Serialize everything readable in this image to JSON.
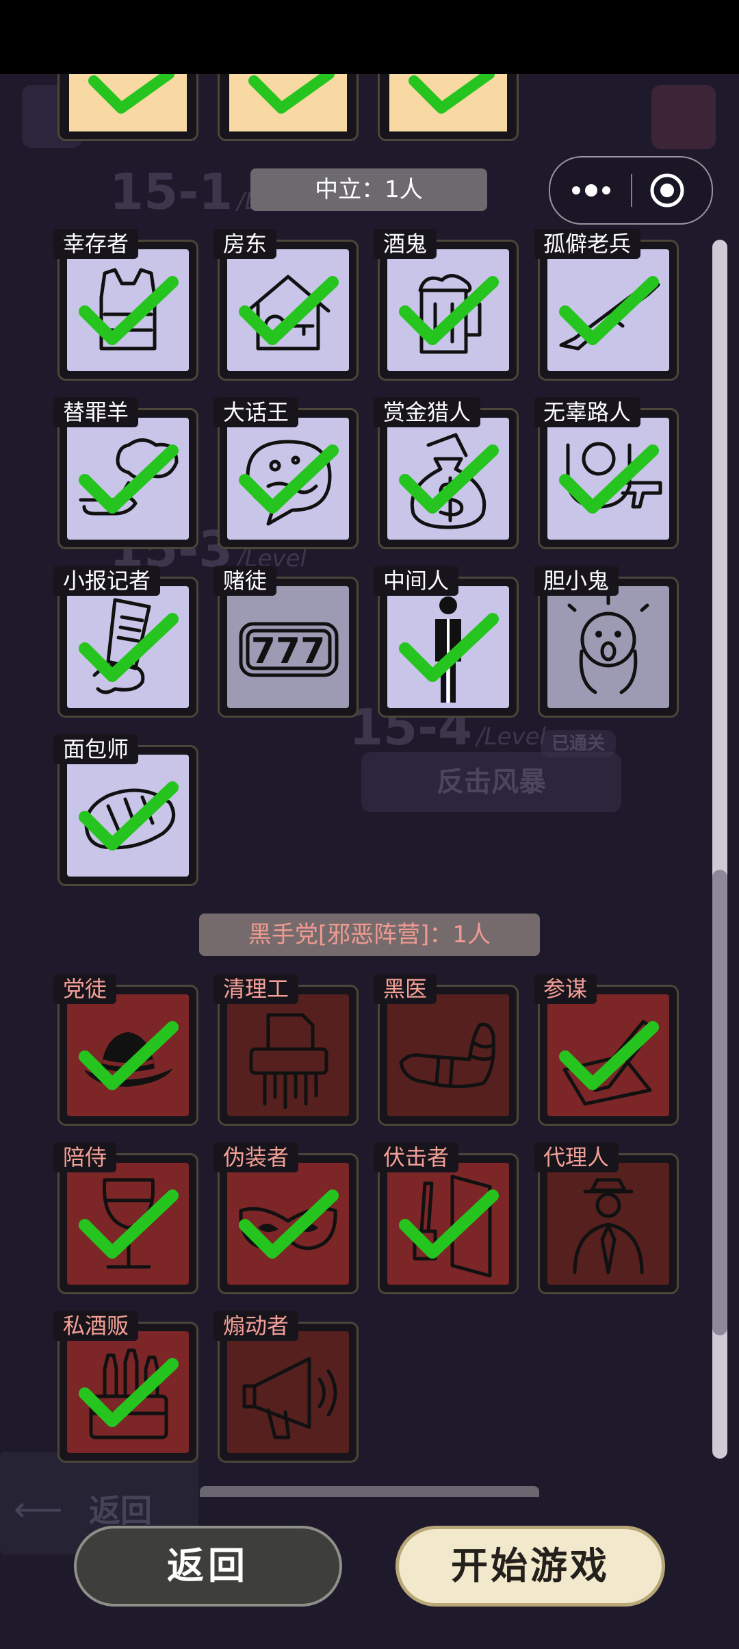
{
  "background": {
    "levels": [
      {
        "num": "15-1",
        "lvl": "/Level"
      },
      {
        "num": "15-3",
        "lvl": "/Level"
      },
      {
        "num": "15-4",
        "lvl": "/Level"
      }
    ],
    "cleared_badge": "已通关",
    "level_name": "反击风暴",
    "bottom_back": "返回"
  },
  "capsule": {
    "more_icon": "more-dots-icon",
    "close_icon": "target-circle-icon"
  },
  "sections": {
    "neutral": {
      "label": "中立：1人",
      "color": "#c8c5e8",
      "roles": [
        {
          "name": "幸存者",
          "icon": "bulletproof-vest-icon",
          "checked": true
        },
        {
          "name": "房东",
          "icon": "house-key-icon",
          "checked": true
        },
        {
          "name": "酒鬼",
          "icon": "beer-mug-icon",
          "checked": true
        },
        {
          "name": "孤僻老兵",
          "icon": "rifle-icon",
          "checked": true
        },
        {
          "name": "替罪羊",
          "icon": "sheep-pointing-icon",
          "checked": true
        },
        {
          "name": "大话王",
          "icon": "speech-bubble-icon",
          "checked": true
        },
        {
          "name": "赏金猎人",
          "icon": "money-bag-icon",
          "checked": true
        },
        {
          "name": "无辜路人",
          "icon": "hands-up-gun-icon",
          "checked": true
        },
        {
          "name": "小报记者",
          "icon": "newspaper-hand-icon",
          "checked": true
        },
        {
          "name": "赌徒",
          "icon": "slot-777-icon",
          "checked": false,
          "text": "777"
        },
        {
          "name": "中间人",
          "icon": "standing-man-icon",
          "checked": true
        },
        {
          "name": "胆小鬼",
          "icon": "scared-face-icon",
          "checked": false
        },
        {
          "name": "面包师",
          "icon": "bread-icon",
          "checked": true
        }
      ]
    },
    "evil": {
      "label": "黑手党[邪恶阵营]：1人",
      "color": "#7c2628",
      "roles": [
        {
          "name": "党徒",
          "icon": "fedora-hat-icon",
          "checked": true
        },
        {
          "name": "清理工",
          "icon": "paper-shredder-icon",
          "checked": false
        },
        {
          "name": "黑医",
          "icon": "bandaged-arm-icon",
          "checked": false
        },
        {
          "name": "参谋",
          "icon": "pen-paper-icon",
          "checked": true
        },
        {
          "name": "陪侍",
          "icon": "wine-glass-icon",
          "checked": true
        },
        {
          "name": "伪装者",
          "icon": "masquerade-mask-icon",
          "checked": true
        },
        {
          "name": "伏击者",
          "icon": "door-knife-icon",
          "checked": true
        },
        {
          "name": "代理人",
          "icon": "suited-man-icon",
          "checked": false
        },
        {
          "name": "私酒贩",
          "icon": "bottle-crate-icon",
          "checked": true
        },
        {
          "name": "煽动者",
          "icon": "megaphone-icon",
          "checked": false
        }
      ]
    }
  },
  "buttons": {
    "back": "返回",
    "start": "开始游戏"
  },
  "colors": {
    "check": "#26c41f",
    "page_bg": "#1e1a2b",
    "top_card": "#f8d9a4"
  }
}
